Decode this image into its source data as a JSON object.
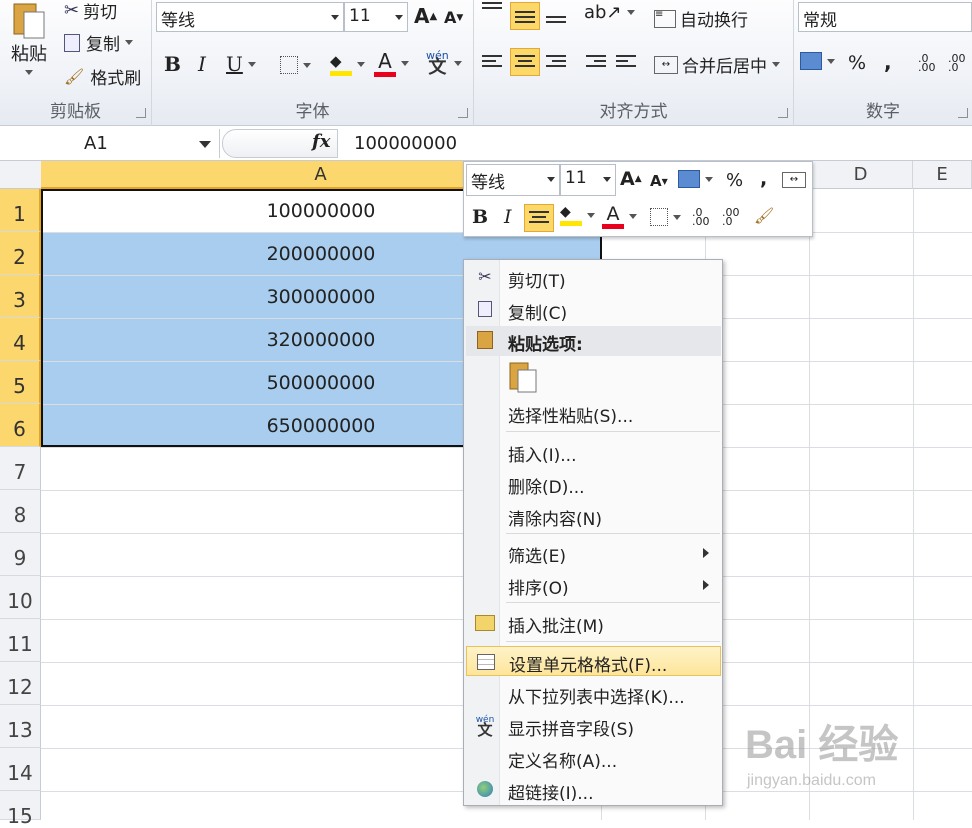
{
  "ribbon": {
    "clipboard": {
      "paste": "粘贴",
      "cut": "剪切",
      "copy": "复制",
      "format_painter": "格式刷",
      "label": "剪贴板"
    },
    "font": {
      "name": "等线",
      "size": "11",
      "bold": "B",
      "italic": "I",
      "underline": "U",
      "font_color_glyph": "A",
      "label": "字体"
    },
    "alignment": {
      "wrap": "自动换行",
      "merge": "合并后居中",
      "label": "对齐方式"
    },
    "number": {
      "format": "常规",
      "percent": "%",
      "comma": ",",
      "label": "数字"
    }
  },
  "formula_bar": {
    "name_box": "A1",
    "fx": "fx",
    "content": "100000000"
  },
  "grid": {
    "columns": [
      "A",
      "D",
      "E"
    ],
    "rows": [
      "1",
      "2",
      "3",
      "4",
      "5",
      "6",
      "7",
      "8",
      "9",
      "10",
      "11",
      "12",
      "13",
      "14",
      "15"
    ],
    "cells": [
      "100000000",
      "200000000",
      "300000000",
      "320000000",
      "500000000",
      "650000000"
    ]
  },
  "mini_toolbar": {
    "font": "等线",
    "size": "11",
    "bold": "B",
    "italic": "I",
    "percent": "%",
    "comma": ",",
    "font_color_glyph": "A"
  },
  "context_menu": {
    "cut": "剪切(T)",
    "copy": "复制(C)",
    "paste_options": "粘贴选项:",
    "paste_special": "选择性粘贴(S)...",
    "insert": "插入(I)...",
    "delete": "删除(D)...",
    "clear": "清除内容(N)",
    "filter": "筛选(E)",
    "sort": "排序(O)",
    "insert_comment": "插入批注(M)",
    "format_cells": "设置单元格格式(F)...",
    "pick_list": "从下拉列表中选择(K)...",
    "phonetic": "显示拼音字段(S)",
    "define_name": "定义名称(A)...",
    "hyperlink": "超链接(I)..."
  },
  "watermark": {
    "logo": "Bai 经验",
    "url": "jingyan.baidu.com"
  },
  "colors": {
    "selection": "#a8cdee",
    "header_selected": "#fbd76d",
    "hover": "#fde59a"
  }
}
